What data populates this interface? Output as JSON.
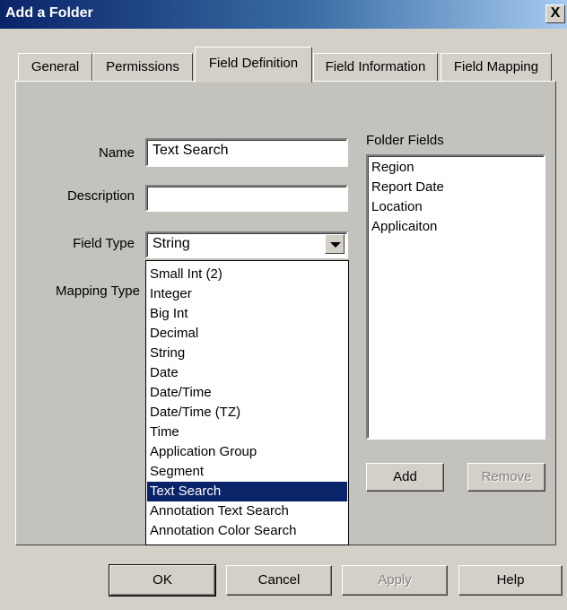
{
  "window": {
    "title": "Add a Folder",
    "close_glyph": "X"
  },
  "tabs": [
    "General",
    "Permissions",
    "Field Definition",
    "Field Information",
    "Field Mapping"
  ],
  "form": {
    "name_label": "Name",
    "name_value": "Text Search",
    "description_label": "Description",
    "description_value": "",
    "field_type_label": "Field Type",
    "field_type_value": "String",
    "mapping_type_label": "Mapping Type"
  },
  "dropdown": {
    "options": [
      "Small Int (2)",
      "Integer",
      "Big Int",
      "Decimal",
      "String",
      "Date",
      "Date/Time",
      "Date/Time (TZ)",
      "Time",
      "Application Group",
      "Segment",
      "Text Search",
      "Annotation Text Search",
      "Annotation Color Search"
    ],
    "highlighted": "Text Search"
  },
  "folder_fields": {
    "label": "Folder Fields",
    "items": [
      "Region",
      "Report Date",
      "Location",
      "Applicaiton"
    ]
  },
  "panel_buttons": {
    "add": "Add",
    "remove": "Remove"
  },
  "footer_buttons": {
    "ok": "OK",
    "cancel": "Cancel",
    "apply": "Apply",
    "help": "Help"
  },
  "colors": {
    "face": "#d4d0c8",
    "titlebar": "#0a246a",
    "selection": "#0a246a"
  }
}
